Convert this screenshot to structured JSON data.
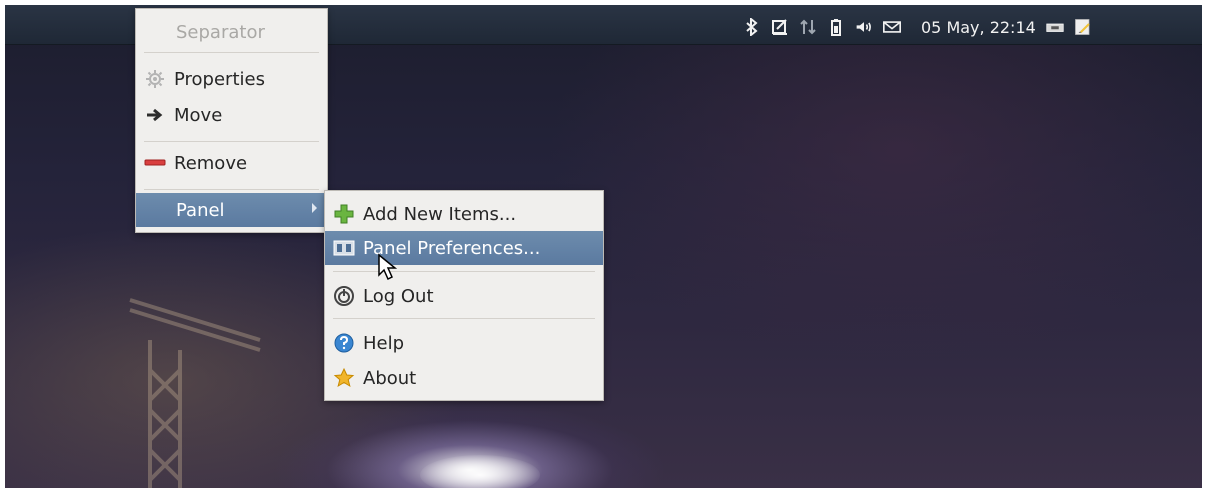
{
  "desktop": {
    "background": "night sky with crane and light flare"
  },
  "topbar": {
    "clock": "05 May, 22:14",
    "tray_icons": [
      "bluetooth-icon",
      "notes-icon",
      "network-icon",
      "battery-icon",
      "volume-icon",
      "mail-icon",
      "drive-icon",
      "edit-icon"
    ]
  },
  "context_menu": {
    "items": [
      {
        "label": "Separator",
        "disabled": true
      },
      {
        "label": "Properties",
        "icon": "gear-icon"
      },
      {
        "label": "Move",
        "icon": "arrow-right-icon"
      },
      {
        "label": "Remove",
        "icon": "minus-icon"
      },
      {
        "label": "Panel",
        "highlighted": true,
        "submenu": true
      }
    ]
  },
  "panel_submenu": {
    "items": [
      {
        "label": "Add New Items...",
        "icon": "add-icon"
      },
      {
        "label": "Panel Preferences...",
        "icon": "panel-preferences-icon",
        "highlighted": true
      },
      {
        "label": "Log Out",
        "icon": "power-icon"
      },
      {
        "label": "Help",
        "icon": "help-icon"
      },
      {
        "label": "About",
        "icon": "star-icon"
      }
    ]
  },
  "colors": {
    "highlight": "#5b7aa0",
    "menu_background": "#f0efed",
    "panel_background": "#1f2836",
    "add_icon": "#6ab540",
    "remove_icon": "#d93f3f",
    "help_icon": "#3a86d1",
    "about_icon": "#f1b52b"
  }
}
